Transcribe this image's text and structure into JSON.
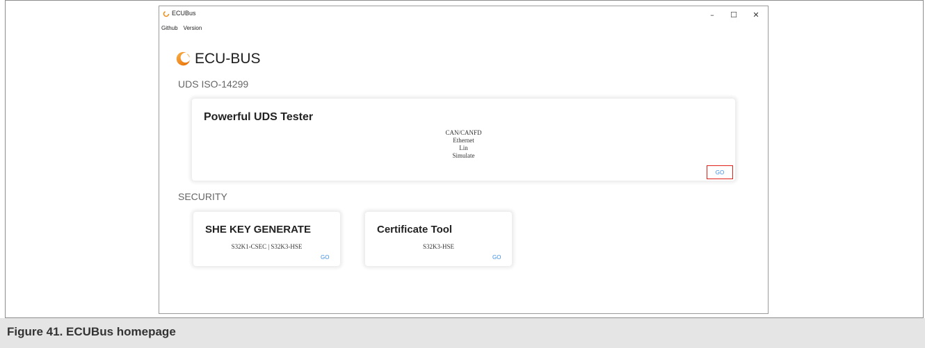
{
  "window": {
    "title": "ECUBus",
    "controls": {
      "minimize": "–",
      "maximize": "☐",
      "close": "✕"
    }
  },
  "menu": {
    "items": [
      {
        "label": "Github"
      },
      {
        "label": "Version"
      }
    ]
  },
  "brand": {
    "name": "ECU-BUS",
    "logo_icon": "ecubus-logo-icon",
    "logo_color": "#f08a10"
  },
  "sections": {
    "uds": {
      "label": "UDS ISO-14299",
      "card": {
        "title": "Powerful UDS Tester",
        "features": [
          "CAN/CANFD",
          "Ethernet",
          "Lin",
          "Simulate"
        ],
        "action": "GO",
        "action_highlighted": true
      }
    },
    "security": {
      "label": "SECURITY",
      "cards": [
        {
          "title": "SHE KEY GENERATE",
          "subtitle": "S32K1-CSEC | S32K3-HSE",
          "action": "GO"
        },
        {
          "title": "Certificate Tool",
          "subtitle": "S32K3-HSE",
          "action": "GO"
        }
      ]
    }
  },
  "caption": "Figure 41.  ECUBus homepage",
  "colors": {
    "link": "#3a8ee6",
    "highlight_border": "#e0201a",
    "caption_band": "#e5e5e5"
  }
}
